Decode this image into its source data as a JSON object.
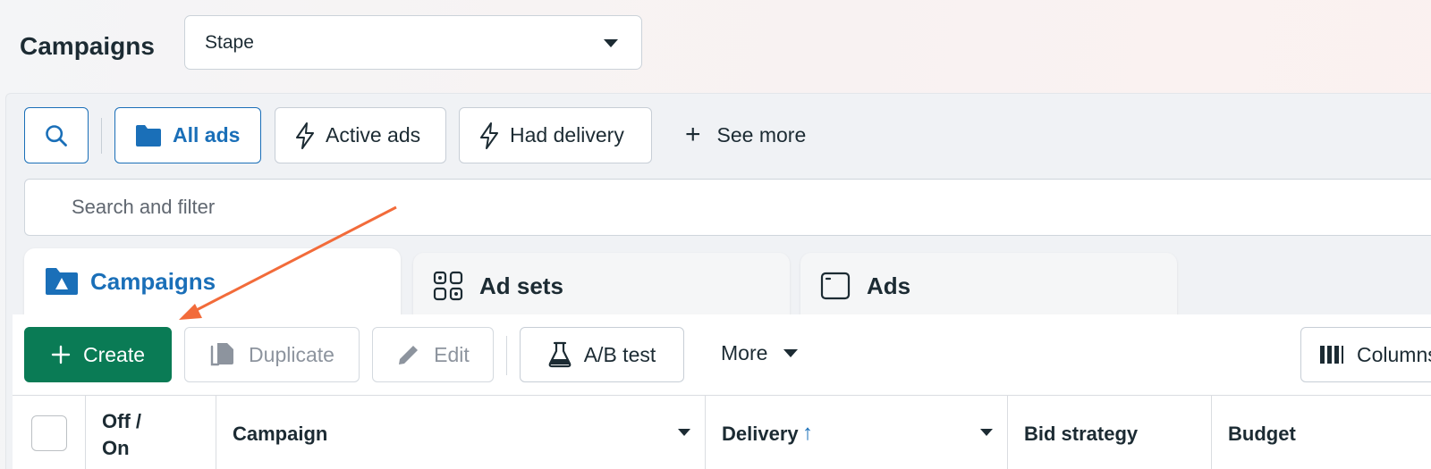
{
  "header": {
    "title": "Campaigns",
    "account_name": "Stape"
  },
  "filter_chips": {
    "all_ads": "All ads",
    "active_ads": "Active ads",
    "had_delivery": "Had delivery",
    "see_more": "See more"
  },
  "search": {
    "placeholder": "Search and filter"
  },
  "level_tabs": {
    "campaigns": "Campaigns",
    "ad_sets": "Ad sets",
    "ads": "Ads"
  },
  "toolbar": {
    "create": "Create",
    "duplicate": "Duplicate",
    "edit": "Edit",
    "ab_test": "A/B test",
    "more": "More",
    "columns": "Columns"
  },
  "table": {
    "columns": [
      "Off / On",
      "Campaign",
      "Delivery",
      "Bid strategy",
      "Budget"
    ],
    "off_on_line1": "Off /",
    "off_on_line2": "On",
    "delivery_sort_arrow": "↑"
  },
  "colors": {
    "accent_blue": "#1a6fb8",
    "create_green": "#0a7b55",
    "annotation_arrow": "#f26b3a"
  }
}
